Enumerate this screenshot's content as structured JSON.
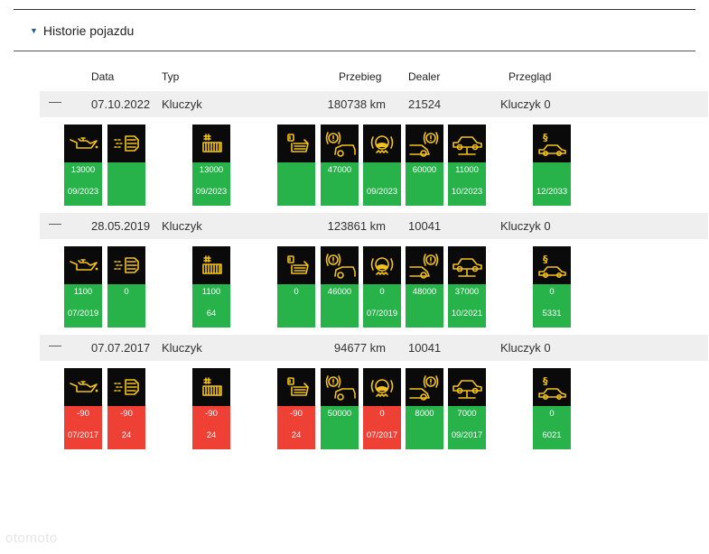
{
  "section": {
    "title": "Historie pojazdu"
  },
  "columns": {
    "data": "Data",
    "typ": "Typ",
    "przebieg": "Przebieg",
    "dealer": "Dealer",
    "przeglad": "Przegląd"
  },
  "colors": {
    "ok": "#27b24a",
    "overdue": "#ef4036",
    "icon_bg": "#0a0a0a",
    "icon_fg": "#f2c21b"
  },
  "icons": [
    "oil-can-icon",
    "air-filter-icon",
    "pollen-filter-icon",
    "fuel-filter-icon",
    "tire-pressure-warning-icon",
    "brake-fluid-icon",
    "front-brake-icon",
    "rear-brake-car-lift-icon",
    "inspection-paragraph-icon"
  ],
  "records": [
    {
      "date": "07.10.2022",
      "type": "Kluczyk",
      "mileage": "180738 km",
      "dealer": "21524",
      "inspection": "Kluczyk 0",
      "tiles": [
        {
          "icon": "oil-can-icon",
          "v1": "13000",
          "v2": "09/2023",
          "status": "green"
        },
        {
          "icon": "air-filter-icon",
          "v1": "",
          "v2": "",
          "status": "green"
        },
        {
          "icon": "pollen-filter-icon",
          "v1": "13000",
          "v2": "09/2023",
          "status": "green"
        },
        {
          "icon": "fuel-filter-icon",
          "v1": "",
          "v2": "",
          "status": "green"
        },
        {
          "icon": "tire-pressure-warning-icon",
          "v1": "47000",
          "v2": "",
          "status": "green"
        },
        {
          "icon": "brake-fluid-icon",
          "v1": "",
          "v2": "09/2023",
          "status": "green"
        },
        {
          "icon": "front-brake-icon",
          "v1": "60000",
          "v2": "",
          "status": "green"
        },
        {
          "icon": "rear-brake-car-lift-icon",
          "v1": "11000",
          "v2": "10/2023",
          "status": "green"
        },
        {
          "icon": "inspection-paragraph-icon",
          "v1": "",
          "v2": "12/2033",
          "status": "green"
        }
      ]
    },
    {
      "date": "28.05.2019",
      "type": "Kluczyk",
      "mileage": "123861 km",
      "dealer": "10041",
      "inspection": "Kluczyk 0",
      "tiles": [
        {
          "icon": "oil-can-icon",
          "v1": "1100",
          "v2": "07/2019",
          "status": "green"
        },
        {
          "icon": "air-filter-icon",
          "v1": "0",
          "v2": "",
          "status": "green"
        },
        {
          "icon": "pollen-filter-icon",
          "v1": "1100",
          "v2": "64",
          "status": "green"
        },
        {
          "icon": "fuel-filter-icon",
          "v1": "0",
          "v2": "",
          "status": "green"
        },
        {
          "icon": "tire-pressure-warning-icon",
          "v1": "46000",
          "v2": "",
          "status": "green"
        },
        {
          "icon": "brake-fluid-icon",
          "v1": "0",
          "v2": "07/2019",
          "status": "green"
        },
        {
          "icon": "front-brake-icon",
          "v1": "48000",
          "v2": "",
          "status": "green"
        },
        {
          "icon": "rear-brake-car-lift-icon",
          "v1": "37000",
          "v2": "10/2021",
          "status": "green"
        },
        {
          "icon": "inspection-paragraph-icon",
          "v1": "0",
          "v2": "5331",
          "status": "green"
        }
      ]
    },
    {
      "date": "07.07.2017",
      "type": "Kluczyk",
      "mileage": "94677 km",
      "dealer": "10041",
      "inspection": "Kluczyk 0",
      "tiles": [
        {
          "icon": "oil-can-icon",
          "v1": "-90",
          "v2": "07/2017",
          "status": "red"
        },
        {
          "icon": "air-filter-icon",
          "v1": "-90",
          "v2": "24",
          "status": "red"
        },
        {
          "icon": "pollen-filter-icon",
          "v1": "-90",
          "v2": "24",
          "status": "red"
        },
        {
          "icon": "fuel-filter-icon",
          "v1": "-90",
          "v2": "24",
          "status": "red"
        },
        {
          "icon": "tire-pressure-warning-icon",
          "v1": "50000",
          "v2": "",
          "status": "green"
        },
        {
          "icon": "brake-fluid-icon",
          "v1": "0",
          "v2": "07/2017",
          "status": "red"
        },
        {
          "icon": "front-brake-icon",
          "v1": "8000",
          "v2": "",
          "status": "green"
        },
        {
          "icon": "rear-brake-car-lift-icon",
          "v1": "7000",
          "v2": "09/2017",
          "status": "green"
        },
        {
          "icon": "inspection-paragraph-icon",
          "v1": "0",
          "v2": "6021",
          "status": "green"
        }
      ]
    }
  ],
  "watermark": "otomoto"
}
